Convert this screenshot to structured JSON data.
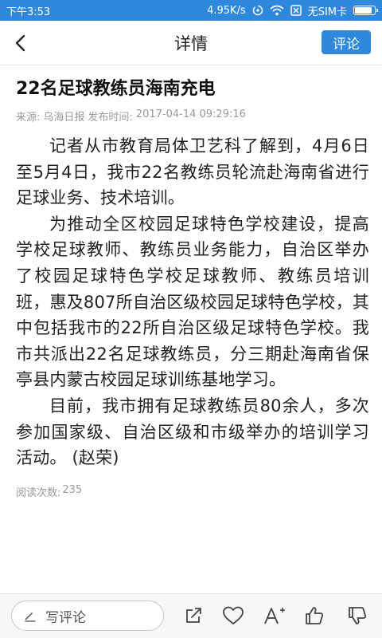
{
  "status_bar": {
    "time": "下午3:53",
    "speed": "4.95K/s",
    "sim": "无SIM卡",
    "battery_level": 0.9
  },
  "header": {
    "title": "详情",
    "comment_label": "评论"
  },
  "article": {
    "title": "22名足球教练员海南充电",
    "source_label": "来源:",
    "source": "乌海日报",
    "publish_label": "发布时间:",
    "publish_time": "2017-04-14 09:29:16",
    "paragraphs": [
      "记者从市教育局体卫艺科了解到，4月6日至5月4日，我市22名教练员轮流赴海南省进行足球业务、技术培训。",
      "为推动全区校园足球特色学校建设，提高学校足球教师、教练员业务能力，自治区举办了校园足球特色学校足球教师、教练员培训班，惠及807所自治区级校园足球特色学校，其中包括我市的22所自治区级足球特色学校。我市共派出22名足球教练员，分三期赴海南省保亭县内蒙古校园足球训练基地学习。",
      "目前，我市拥有足球教练员80余人，多次参加国家级、自治区级和市级举办的培训学习活动。 (赵荣)"
    ],
    "read_label": "阅读次数:",
    "read_count": "235"
  },
  "bottom_bar": {
    "write_comment_placeholder": "写评论",
    "icons": [
      "share-icon",
      "heart-icon",
      "font-size-icon",
      "thumb-up-icon",
      "thumb-down-icon"
    ]
  },
  "colors": {
    "accent": "#2f88dc",
    "meta": "#9a9a9a"
  }
}
